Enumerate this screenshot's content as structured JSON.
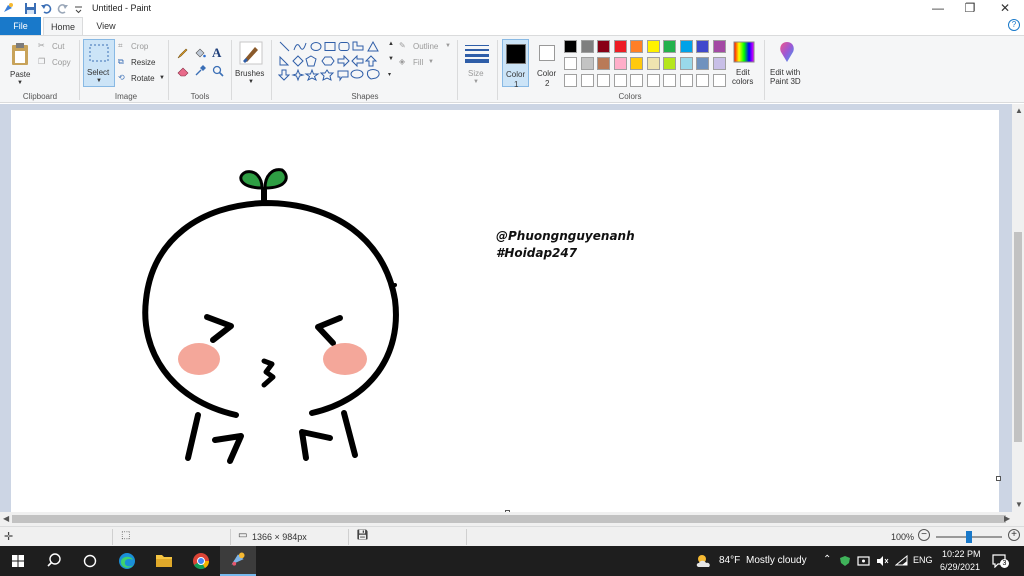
{
  "window": {
    "title": "Untitled - Paint",
    "minimize": "—",
    "restore": "❐",
    "close": "✕"
  },
  "tabs": {
    "file": "File",
    "home": "Home",
    "view": "View",
    "help": "?"
  },
  "ribbon": {
    "clipboard": {
      "paste": "Paste",
      "cut": "Cut",
      "copy": "Copy",
      "group": "Clipboard"
    },
    "image": {
      "select": "Select",
      "crop": "Crop",
      "resize": "Resize",
      "rotate": "Rotate",
      "group": "Image"
    },
    "tools": {
      "group": "Tools",
      "text_tool": "A"
    },
    "brushes": {
      "label": "Brushes"
    },
    "shapes": {
      "outline": "Outline",
      "fill": "Fill",
      "group": "Shapes"
    },
    "size": {
      "label": "Size"
    },
    "colors": {
      "color1_label": "Color",
      "color1_num": "1",
      "color2_label": "Color",
      "color2_num": "2",
      "color1": "#000000",
      "color2": "#ffffff",
      "palette": [
        "#000000",
        "#7f7f7f",
        "#880015",
        "#ed1c24",
        "#ff7f27",
        "#fff200",
        "#22b14c",
        "#00a2e8",
        "#3f48cc",
        "#a349a4",
        "#ffffff",
        "#c3c3c3",
        "#b97a57",
        "#ffaec9",
        "#ffc90e",
        "#efe4b0",
        "#b5e61d",
        "#99d9ea",
        "#7092be",
        "#c8bfe7",
        "#ffffff",
        "#ffffff",
        "#ffffff",
        "#ffffff",
        "#ffffff",
        "#ffffff",
        "#ffffff",
        "#ffffff",
        "#ffffff",
        "#ffffff"
      ],
      "edit_colors_1": "Edit",
      "edit_colors_2": "colors",
      "paint3d_1": "Edit with",
      "paint3d_2": "Paint 3D",
      "group": "Colors"
    }
  },
  "canvas": {
    "text_line1": "@Phuongnguyenanh",
    "text_line2": "#Hoidap247",
    "drawing": {
      "outline_color": "#000000",
      "leaf_color": "#2e9e43",
      "cheek_color": "#f4a79a"
    }
  },
  "statusbar": {
    "dimensions": "1366 × 984px",
    "zoom": "100%",
    "zoom_level": 0.5
  },
  "taskbar": {
    "weather_temp": "84°F",
    "weather_text": "Mostly cloudy",
    "language": "ENG",
    "time": "10:22 PM",
    "date": "6/29/2021",
    "notifications": "3"
  }
}
